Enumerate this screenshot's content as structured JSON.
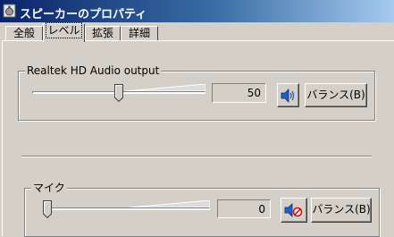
{
  "window": {
    "title": "スピーカーのプロパティ",
    "icon": "speaker-properties-icon"
  },
  "tabs": [
    {
      "label": "全般",
      "active": false
    },
    {
      "label": "レベル",
      "active": true
    },
    {
      "label": "拡張",
      "active": false
    },
    {
      "label": "詳細",
      "active": false
    }
  ],
  "devices": [
    {
      "name": "Realtek HD Audio output",
      "level": 50,
      "level_fraction": 0.5,
      "muted": false,
      "speaker_icon": "speaker-icon",
      "balance_label": "バランス(B)"
    },
    {
      "name": "マイク",
      "level": 0,
      "level_fraction": 0.0,
      "muted": true,
      "speaker_icon": "speaker-muted-icon",
      "balance_label": "バランス(B)"
    }
  ]
}
